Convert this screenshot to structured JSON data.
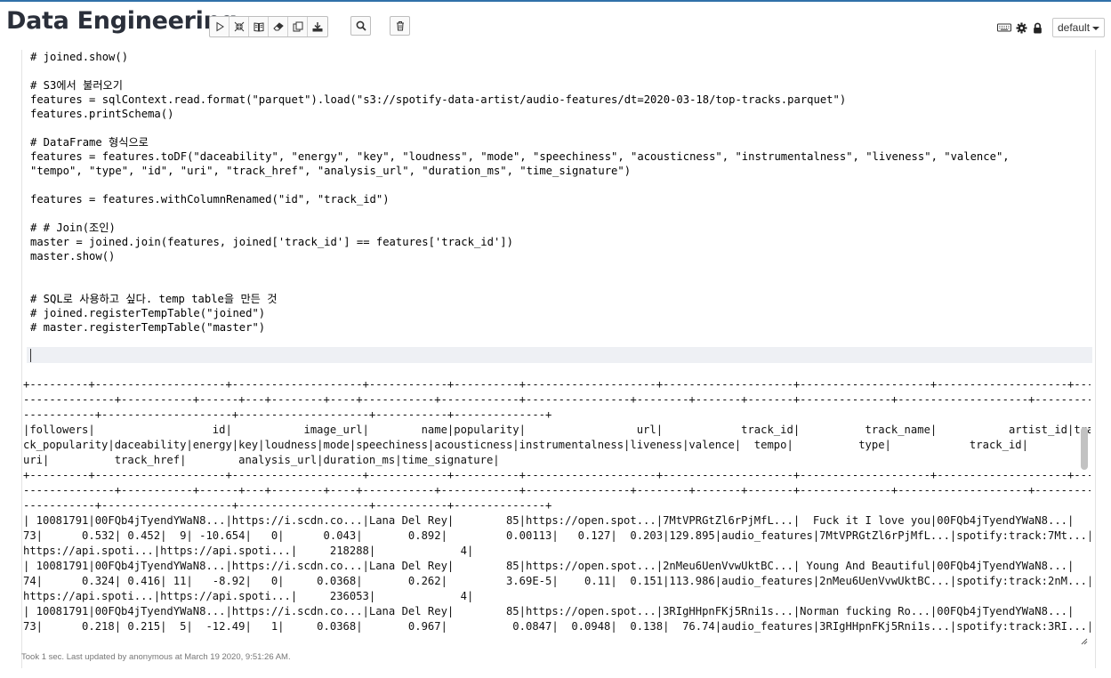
{
  "header": {
    "title": "Data Engineering",
    "toolbar_icons": [
      "play-icon",
      "collapse-icon",
      "book-icon",
      "eraser-icon",
      "copy-icon",
      "download-icon"
    ],
    "search_icon": "search-icon",
    "trash_icon": "trash-icon",
    "right_icons": [
      "keyboard-icon",
      "gear-icon",
      "lock-icon"
    ],
    "interpreter_select": "default"
  },
  "editor": {
    "lines": [
      "# joined.show()",
      "",
      "# S3에서 불러오기",
      "features = sqlContext.read.format(\"parquet\").load(\"s3://spotify-data-artist/audio-features/dt=2020-03-18/top-tracks.parquet\")",
      "features.printSchema()",
      "",
      "# DataFrame 형식으로",
      "features = features.toDF(\"daceability\", \"energy\", \"key\", \"loudness\", \"mode\", \"speechiness\", \"acousticness\", \"instrumentalness\", \"liveness\", \"valence\",",
      "\"tempo\", \"type\", \"id\", \"uri\", \"track_href\", \"analysis_url\", \"duration_ms\", \"time_signature\")",
      "",
      "features = features.withColumnRenamed(\"id\", \"track_id\")",
      "",
      "# # Join(조인)",
      "master = joined.join(features, joined['track_id'] == features['track_id'])",
      "master.show()",
      "",
      "",
      "# SQL로 사용하고 싶다. temp table을 만든 것",
      "# joined.registerTempTable(\"joined\")",
      "# master.registerTempTable(\"master\")"
    ]
  },
  "output": {
    "lines": [
      "+---------+--------------------+--------------------+------------+----------+--------------------+--------------------+--------------------+--------------------+---",
      "--------------+-----------+------+---+--------+----+-----------+------------+----------------+--------+-------+-------+--------------+--------------------+-------------------",
      "-----------+--------------------+--------------------+-----------+--------------+",
      "|followers|                  id|           image_url|        name|popularity|                 url|            track_id|          track_name|           artist_id|tra",
      "ck_popularity|daceability|energy|key|loudness|mode|speechiness|acousticness|instrumentalness|liveness|valence|  tempo|          type|            track_id|",
      "uri|          track_href|        analysis_url|duration_ms|time_signature|",
      "+---------+--------------------+--------------------+------------+----------+--------------------+--------------------+--------------------+--------------------+---",
      "--------------+-----------+------+---+--------+----+-----------+------------+----------------+--------+-------+-------+--------------+--------------------+-------------------",
      "-----------+--------------------+--------------------+-----------+--------------+",
      "| 10081791|00FQb4jTyendYWaN8...|https://i.scdn.co...|Lana Del Rey|        85|https://open.spot...|7MtVPRGtZl6rPjMfL...|  Fuck it I love you|00FQb4jTyendYWaN8...|",
      "73|      0.532| 0.452|  9| -10.654|   0|      0.043|       0.892|         0.00113|   0.127|  0.203|129.895|audio_features|7MtVPRGtZl6rPjMfL...|spotify:track:7Mt...|",
      "https://api.spoti...|https://api.spoti...|     218288|             4|",
      "| 10081791|00FQb4jTyendYWaN8...|https://i.scdn.co...|Lana Del Rey|        85|https://open.spot...|2nMeu6UenVvwUktBC...| Young And Beautiful|00FQb4jTyendYWaN8...|",
      "74|      0.324| 0.416| 11|   -8.92|   0|     0.0368|       0.262|         3.69E-5|    0.11|  0.151|113.986|audio_features|2nMeu6UenVvwUktBC...|spotify:track:2nM...|",
      "https://api.spoti...|https://api.spoti...|     236053|             4|",
      "| 10081791|00FQb4jTyendYWaN8...|https://i.scdn.co...|Lana Del Rey|        85|https://open.spot...|3RIgHHpnFKj5Rni1s...|Norman fucking Ro...|00FQb4jTyendYWaN8...|",
      "73|      0.218| 0.215|  5|  -12.49|   1|     0.0368|       0.967|          0.0847|  0.0948|  0.138|  76.74|audio_features|3RIgHHpnFKj5Rni1s...|spotify:track:3RI...|"
    ]
  },
  "footer": {
    "status": "Took 1 sec. Last updated by anonymous at March 19 2020, 9:51:26 AM."
  }
}
